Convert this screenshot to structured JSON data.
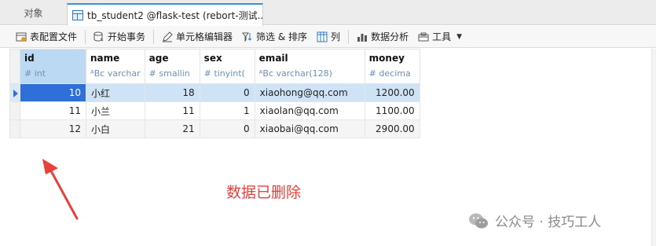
{
  "tabs": {
    "objects_label": "对象",
    "active_title": "tb_student2 @flask-test (rebort-测试..."
  },
  "toolbar": {
    "items": [
      {
        "label": "表配置文件",
        "icon": "table-config-icon"
      },
      {
        "label": "开始事务",
        "icon": "database-transaction-icon"
      },
      {
        "label": "单元格编辑器",
        "icon": "cell-editor-icon"
      },
      {
        "label": "筛选 & 排序",
        "icon": "filter-sort-icon"
      },
      {
        "label": "列",
        "icon": "columns-icon"
      },
      {
        "label": "数据分析",
        "icon": "data-analysis-icon"
      },
      {
        "label": "工具",
        "icon": "tools-icon"
      }
    ]
  },
  "grid": {
    "columns": [
      {
        "name": "id",
        "type": "int",
        "type_glyph": "#"
      },
      {
        "name": "name",
        "type": "varchar",
        "type_glyph": "ᴬBc"
      },
      {
        "name": "age",
        "type": "smallin",
        "type_glyph": "#"
      },
      {
        "name": "sex",
        "type": "tinyint(",
        "type_glyph": "#"
      },
      {
        "name": "email",
        "type": "varchar(128)",
        "type_glyph": "ᴬBc"
      },
      {
        "name": "money",
        "type": "decima",
        "type_glyph": "#"
      }
    ],
    "rows": [
      {
        "id": "10",
        "name": "小红",
        "age": "18",
        "sex": "0",
        "email": "xiaohong@qq.com",
        "money": "1200.00"
      },
      {
        "id": "11",
        "name": "小兰",
        "age": "11",
        "sex": "1",
        "email": "xiaolan@qq.com",
        "money": "1100.00"
      },
      {
        "id": "12",
        "name": "小白",
        "age": "21",
        "sex": "0",
        "email": "xiaobai@qq.com",
        "money": "2900.00"
      }
    ],
    "selected_row": 0
  },
  "annotation": {
    "text": "数据已删除",
    "color": "#e8413a"
  },
  "watermark": {
    "text": "公众号 · 技巧工人"
  },
  "colors": {
    "accent": "#2f6fd8",
    "selected_row": "#cfe3f7",
    "header_selected": "#bcd9f3"
  }
}
